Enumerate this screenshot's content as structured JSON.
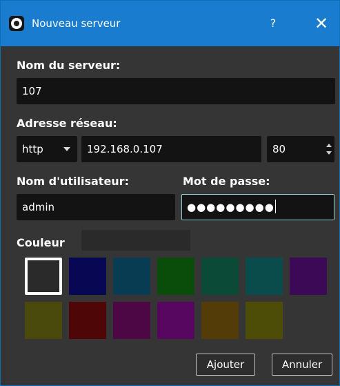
{
  "window": {
    "title": "Nouveau serveur",
    "help": "?",
    "close": "✕"
  },
  "server_name": {
    "label": "Nom du serveur:",
    "value": "107"
  },
  "address": {
    "label": "Adresse réseau:",
    "protocol": "http",
    "host": "192.168.0.107",
    "port": "80"
  },
  "credentials": {
    "user_label": "Nom d'utilisateur:",
    "user_value": "admin",
    "password_label": "Mot de passe:",
    "password_masked": "●●●●●●●●●"
  },
  "color": {
    "label": "Couleur",
    "current": "#2a2a2a",
    "selected_index": 0,
    "swatches": [
      "#2a2a2a",
      "#070754",
      "#083c52",
      "#0a4d0b",
      "#0b4a36",
      "#0a4b4b",
      "#3b0955",
      "#4a4a0d",
      "#4f0606",
      "#4d0744",
      "#570760",
      "#533c08",
      "#4d4d07"
    ]
  },
  "buttons": {
    "add": "Ajouter",
    "cancel": "Annuler"
  }
}
